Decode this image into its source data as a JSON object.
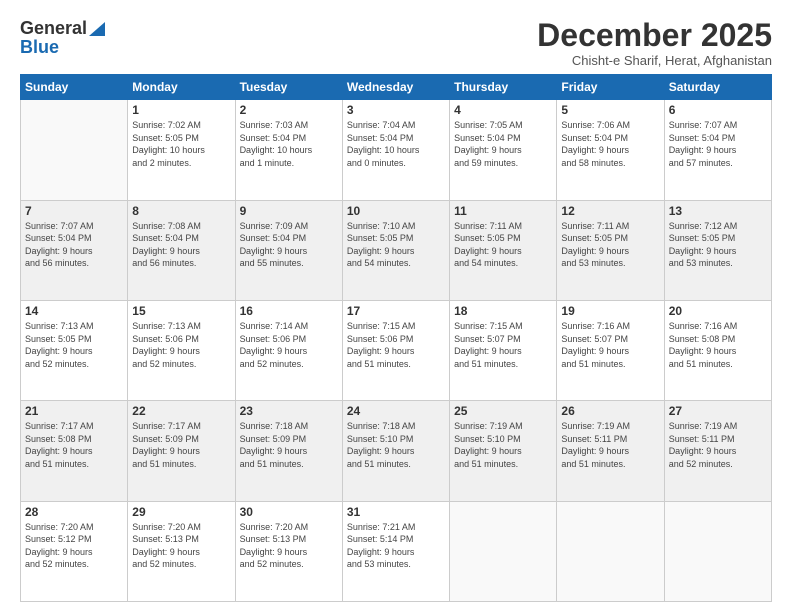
{
  "header": {
    "logo_general": "General",
    "logo_blue": "Blue",
    "month_title": "December 2025",
    "location": "Chisht-e Sharif, Herat, Afghanistan"
  },
  "weekdays": [
    "Sunday",
    "Monday",
    "Tuesday",
    "Wednesday",
    "Thursday",
    "Friday",
    "Saturday"
  ],
  "weeks": [
    [
      {
        "day": "",
        "info": ""
      },
      {
        "day": "1",
        "info": "Sunrise: 7:02 AM\nSunset: 5:05 PM\nDaylight: 10 hours\nand 2 minutes."
      },
      {
        "day": "2",
        "info": "Sunrise: 7:03 AM\nSunset: 5:04 PM\nDaylight: 10 hours\nand 1 minute."
      },
      {
        "day": "3",
        "info": "Sunrise: 7:04 AM\nSunset: 5:04 PM\nDaylight: 10 hours\nand 0 minutes."
      },
      {
        "day": "4",
        "info": "Sunrise: 7:05 AM\nSunset: 5:04 PM\nDaylight: 9 hours\nand 59 minutes."
      },
      {
        "day": "5",
        "info": "Sunrise: 7:06 AM\nSunset: 5:04 PM\nDaylight: 9 hours\nand 58 minutes."
      },
      {
        "day": "6",
        "info": "Sunrise: 7:07 AM\nSunset: 5:04 PM\nDaylight: 9 hours\nand 57 minutes."
      }
    ],
    [
      {
        "day": "7",
        "info": "Sunrise: 7:07 AM\nSunset: 5:04 PM\nDaylight: 9 hours\nand 56 minutes."
      },
      {
        "day": "8",
        "info": "Sunrise: 7:08 AM\nSunset: 5:04 PM\nDaylight: 9 hours\nand 56 minutes."
      },
      {
        "day": "9",
        "info": "Sunrise: 7:09 AM\nSunset: 5:04 PM\nDaylight: 9 hours\nand 55 minutes."
      },
      {
        "day": "10",
        "info": "Sunrise: 7:10 AM\nSunset: 5:05 PM\nDaylight: 9 hours\nand 54 minutes."
      },
      {
        "day": "11",
        "info": "Sunrise: 7:11 AM\nSunset: 5:05 PM\nDaylight: 9 hours\nand 54 minutes."
      },
      {
        "day": "12",
        "info": "Sunrise: 7:11 AM\nSunset: 5:05 PM\nDaylight: 9 hours\nand 53 minutes."
      },
      {
        "day": "13",
        "info": "Sunrise: 7:12 AM\nSunset: 5:05 PM\nDaylight: 9 hours\nand 53 minutes."
      }
    ],
    [
      {
        "day": "14",
        "info": "Sunrise: 7:13 AM\nSunset: 5:05 PM\nDaylight: 9 hours\nand 52 minutes."
      },
      {
        "day": "15",
        "info": "Sunrise: 7:13 AM\nSunset: 5:06 PM\nDaylight: 9 hours\nand 52 minutes."
      },
      {
        "day": "16",
        "info": "Sunrise: 7:14 AM\nSunset: 5:06 PM\nDaylight: 9 hours\nand 52 minutes."
      },
      {
        "day": "17",
        "info": "Sunrise: 7:15 AM\nSunset: 5:06 PM\nDaylight: 9 hours\nand 51 minutes."
      },
      {
        "day": "18",
        "info": "Sunrise: 7:15 AM\nSunset: 5:07 PM\nDaylight: 9 hours\nand 51 minutes."
      },
      {
        "day": "19",
        "info": "Sunrise: 7:16 AM\nSunset: 5:07 PM\nDaylight: 9 hours\nand 51 minutes."
      },
      {
        "day": "20",
        "info": "Sunrise: 7:16 AM\nSunset: 5:08 PM\nDaylight: 9 hours\nand 51 minutes."
      }
    ],
    [
      {
        "day": "21",
        "info": "Sunrise: 7:17 AM\nSunset: 5:08 PM\nDaylight: 9 hours\nand 51 minutes."
      },
      {
        "day": "22",
        "info": "Sunrise: 7:17 AM\nSunset: 5:09 PM\nDaylight: 9 hours\nand 51 minutes."
      },
      {
        "day": "23",
        "info": "Sunrise: 7:18 AM\nSunset: 5:09 PM\nDaylight: 9 hours\nand 51 minutes."
      },
      {
        "day": "24",
        "info": "Sunrise: 7:18 AM\nSunset: 5:10 PM\nDaylight: 9 hours\nand 51 minutes."
      },
      {
        "day": "25",
        "info": "Sunrise: 7:19 AM\nSunset: 5:10 PM\nDaylight: 9 hours\nand 51 minutes."
      },
      {
        "day": "26",
        "info": "Sunrise: 7:19 AM\nSunset: 5:11 PM\nDaylight: 9 hours\nand 51 minutes."
      },
      {
        "day": "27",
        "info": "Sunrise: 7:19 AM\nSunset: 5:11 PM\nDaylight: 9 hours\nand 52 minutes."
      }
    ],
    [
      {
        "day": "28",
        "info": "Sunrise: 7:20 AM\nSunset: 5:12 PM\nDaylight: 9 hours\nand 52 minutes."
      },
      {
        "day": "29",
        "info": "Sunrise: 7:20 AM\nSunset: 5:13 PM\nDaylight: 9 hours\nand 52 minutes."
      },
      {
        "day": "30",
        "info": "Sunrise: 7:20 AM\nSunset: 5:13 PM\nDaylight: 9 hours\nand 52 minutes."
      },
      {
        "day": "31",
        "info": "Sunrise: 7:21 AM\nSunset: 5:14 PM\nDaylight: 9 hours\nand 53 minutes."
      },
      {
        "day": "",
        "info": ""
      },
      {
        "day": "",
        "info": ""
      },
      {
        "day": "",
        "info": ""
      }
    ]
  ]
}
